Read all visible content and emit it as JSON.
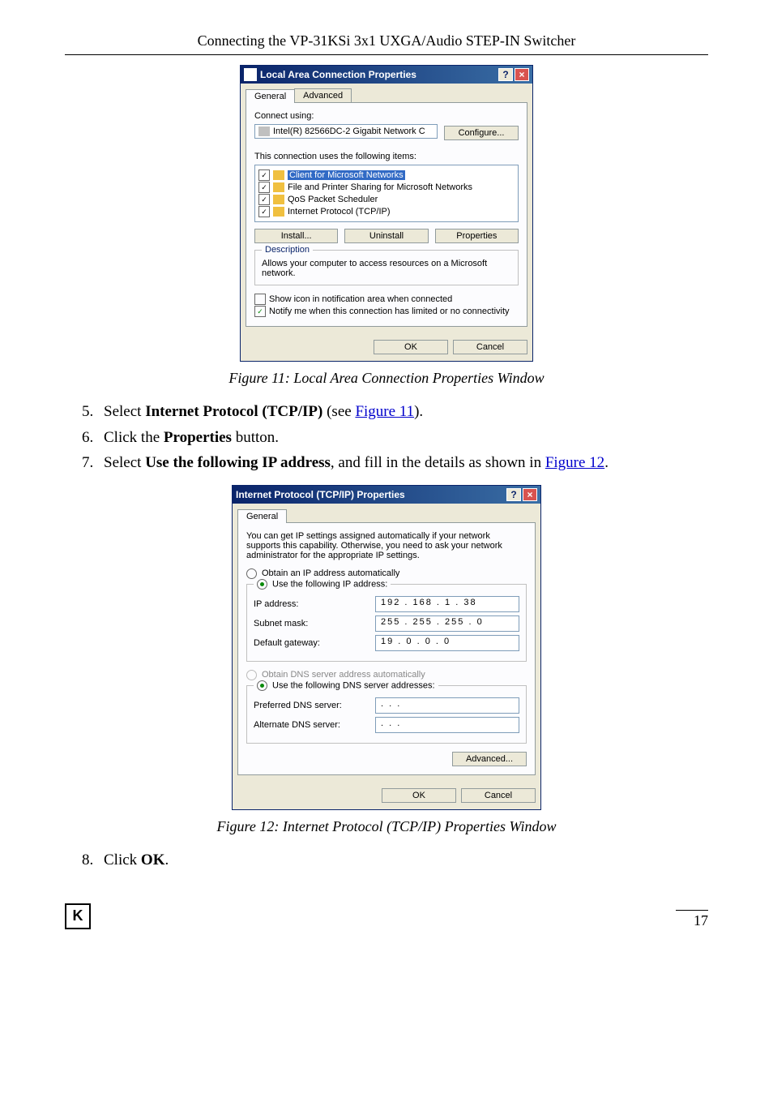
{
  "header": "Connecting the VP-31KSi 3x1 UXGA/Audio STEP-IN Switcher",
  "dlg1": {
    "title": "Local Area Connection Properties",
    "tab_general": "General",
    "tab_advanced": "Advanced",
    "connect_using": "Connect using:",
    "adapter": "Intel(R) 82566DC-2 Gigabit Network C",
    "configure": "Configure...",
    "uses_items": "This connection uses the following items:",
    "items": [
      "Client for Microsoft Networks",
      "File and Printer Sharing for Microsoft Networks",
      "QoS Packet Scheduler",
      "Internet Protocol (TCP/IP)"
    ],
    "install": "Install...",
    "uninstall": "Uninstall",
    "properties": "Properties",
    "desc_title": "Description",
    "desc_text": "Allows your computer to access resources on a Microsoft network.",
    "show_icon": "Show icon in notification area when connected",
    "notify": "Notify me when this connection has limited or no connectivity",
    "ok": "OK",
    "cancel": "Cancel"
  },
  "cap1": "Figure 11: Local Area Connection Properties Window",
  "list": {
    "s5a": "Select ",
    "s5b": "Internet Protocol (TCP/IP)",
    "s5c": " (see ",
    "s5link": "Figure 11",
    "s5d": ").",
    "s6a": "Click the ",
    "s6b": "Properties",
    "s6c": " button.",
    "s7a": "Select ",
    "s7b": "Use the following IP address",
    "s7c": ", and fill in the details as shown in ",
    "s7link": "Figure 12",
    "s7d": ".",
    "s8a": "Click ",
    "s8b": "OK",
    "s8c": "."
  },
  "dlg2": {
    "title": "Internet Protocol (TCP/IP) Properties",
    "tab_general": "General",
    "intro": "You can get IP settings assigned automatically if your network supports this capability. Otherwise, you need to ask your network administrator for the appropriate IP settings.",
    "obtain_ip": "Obtain an IP address automatically",
    "use_ip": "Use the following IP address:",
    "lbl_ip": "IP address:",
    "val_ip": "192 . 168 .   1  .  38",
    "lbl_mask": "Subnet mask:",
    "val_mask": "255 . 255 . 255 .   0",
    "lbl_gw": "Default gateway:",
    "val_gw": " 19 .   0  .   0  .   0",
    "obtain_dns": "Obtain DNS server address automatically",
    "use_dns": "Use the following DNS server addresses:",
    "lbl_pref": "Preferred DNS server:",
    "val_pref": "    .       .       .    ",
    "lbl_alt": "Alternate DNS server:",
    "val_alt": "    .       .       .    ",
    "advanced": "Advanced...",
    "ok": "OK",
    "cancel": "Cancel"
  },
  "cap2": "Figure 12: Internet Protocol (TCP/IP) Properties Window",
  "pagenum": "17"
}
